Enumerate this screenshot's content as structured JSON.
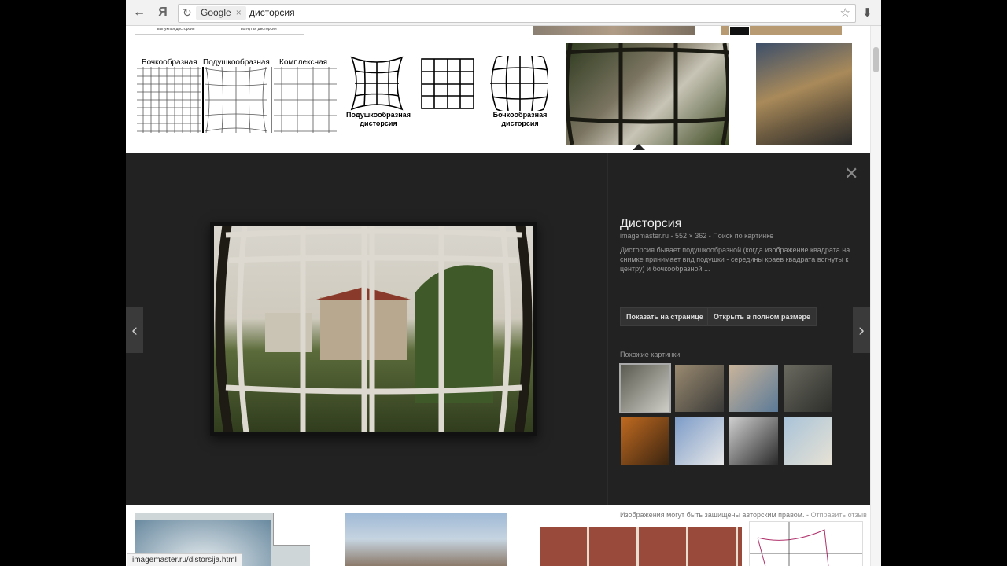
{
  "toolbar": {
    "back_icon": "arrow-left-icon",
    "yandex_label": "Я",
    "reload_icon": "reload-icon",
    "chip_label": "Google",
    "chip_close": "×",
    "query": "дисторсия",
    "star_icon": "star-icon",
    "download_icon": "download-icon"
  },
  "top_images": {
    "labels": [
      "Бочкообразная",
      "Подушкообразная",
      "Комплексная"
    ],
    "pillow_caption": "Подушкообразная дисторсия",
    "barrel_caption": "Бочкообразная дисторсия",
    "strip_left": "выпуклая дисторсия",
    "strip_right": "вогнутая дисторсия"
  },
  "panel": {
    "title": "Дисторсия",
    "meta": "imagemaster.ru  -  552 × 362  -  Поиск по картинке",
    "description": "Дисторсия бывает подушкообразной (когда изображение квадрата на снимке принимает вид подушки - середины краев квадрата вогнуты к центру) и бочкообразной ...",
    "btn_page": "Показать на странице",
    "btn_full": "Открыть в полном размере",
    "similar_label": "Похожие картинки",
    "footer_text": "Изображения могут быть защищены авторским правом.",
    "footer_link": "Отправить отзыв",
    "close_icon": "close-icon",
    "prev_icon": "chevron-left-icon",
    "next_icon": "chevron-right-icon",
    "thumbs": [
      {
        "name": "thumb-window",
        "colors": [
          "#5a5a50",
          "#cfcfc8"
        ]
      },
      {
        "name": "thumb-street",
        "colors": [
          "#9a8a70",
          "#3a3a38"
        ]
      },
      {
        "name": "thumb-beach",
        "colors": [
          "#c9b49a",
          "#5b7a98"
        ]
      },
      {
        "name": "thumb-fountain",
        "colors": [
          "#6a6a60",
          "#2d2d2a"
        ]
      },
      {
        "name": "thumb-autumn",
        "colors": [
          "#c06a20",
          "#3a2410"
        ]
      },
      {
        "name": "thumb-church",
        "colors": [
          "#7d9cc8",
          "#e8e8e8"
        ]
      },
      {
        "name": "thumb-bw",
        "colors": [
          "#cfcfcf",
          "#2a2a2a"
        ]
      },
      {
        "name": "thumb-boat",
        "colors": [
          "#a9c3d8",
          "#e7e2d5"
        ]
      }
    ]
  },
  "status_url": "imagemaster.ru/distorsija.html",
  "colors": {
    "panel": "#222222",
    "button": "#333333",
    "accent": "#eeeeee"
  }
}
